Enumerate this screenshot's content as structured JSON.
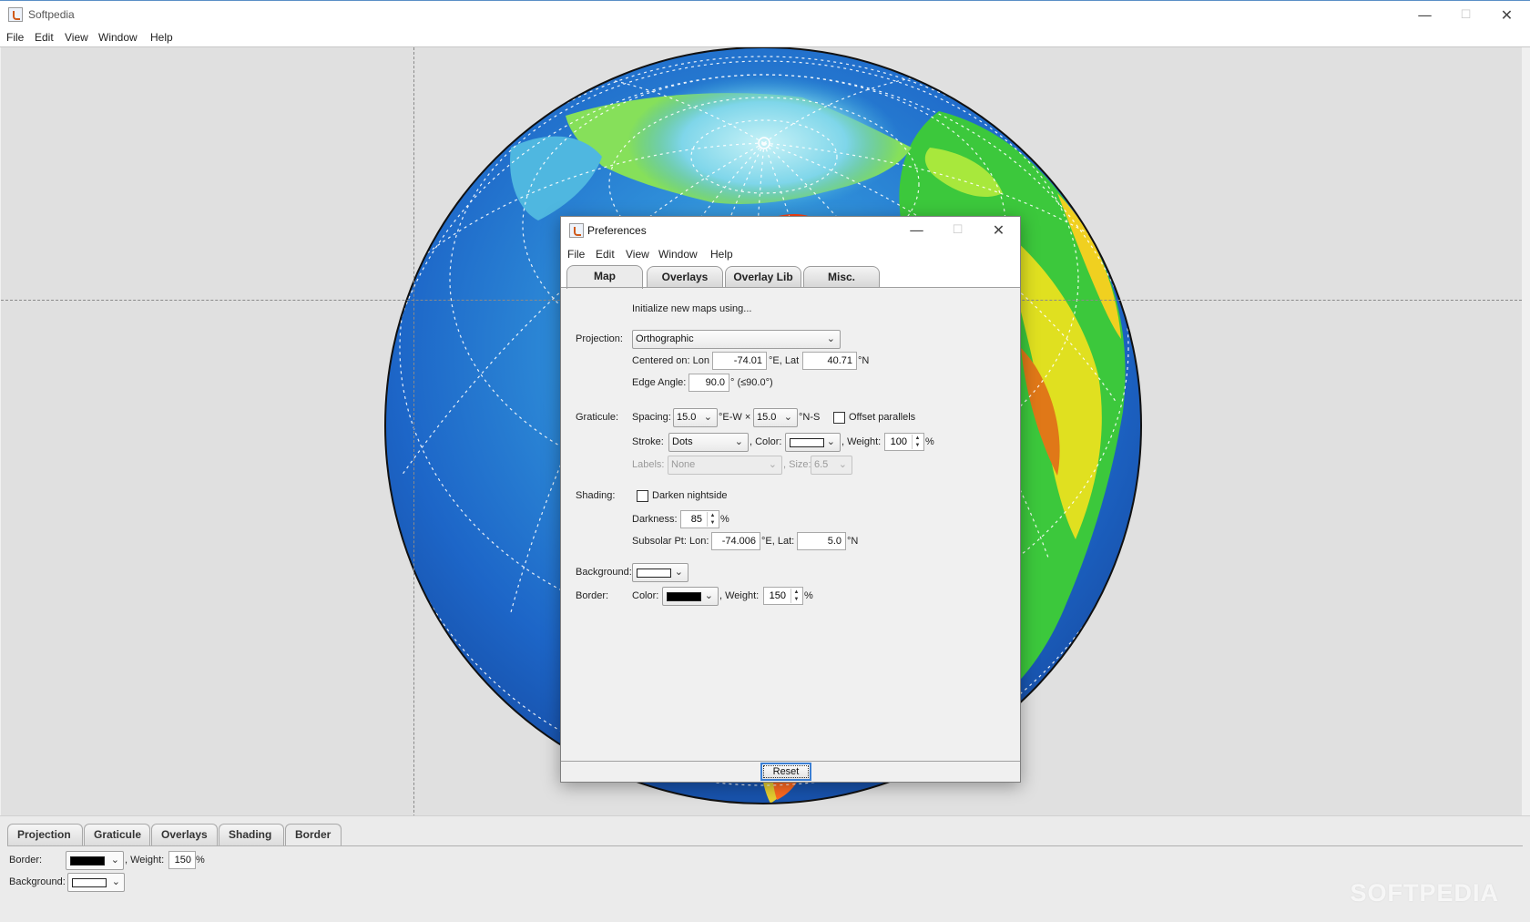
{
  "window": {
    "title": "Softpedia",
    "controls": {
      "minimize": "—",
      "maximize": "☐",
      "close": "✕"
    }
  },
  "menu": [
    "File",
    "Edit",
    "View",
    "Window",
    "Help"
  ],
  "bottom_panel": {
    "tabs": [
      "Projection",
      "Graticule",
      "Overlays",
      "Shading",
      "Border"
    ],
    "active_tab": "Border",
    "border_label": "Border:",
    "weight_label": ", Weight:",
    "weight_value": "150",
    "percent": "%",
    "background_label": "Background:",
    "border_color": "#000000",
    "background_color": "#ffffff"
  },
  "watermark": "SOFTPEDIA",
  "preferences": {
    "title": "Preferences",
    "controls": {
      "minimize": "—",
      "maximize": "☐",
      "close": "✕"
    },
    "menu": [
      "File",
      "Edit",
      "View",
      "Window",
      "Help"
    ],
    "tabs": [
      "Map",
      "Overlays",
      "Overlay Lib",
      "Misc."
    ],
    "active_tab": "Map",
    "intro": "Initialize new maps using...",
    "projection": {
      "label": "Projection:",
      "value": "Orthographic",
      "centered_label": "Centered on: Lon",
      "lon": "-74.01",
      "lon_unit": "°E, Lat",
      "lat": "40.71",
      "lat_unit": "°N",
      "edge_label": "Edge Angle:",
      "edge_value": "90.0",
      "edge_suffix": "° (≤90.0°)"
    },
    "graticule": {
      "label": "Graticule:",
      "spacing_label": "Spacing:",
      "spacing_ew": "15.0",
      "ew_unit": "°E-W ×",
      "spacing_ns": "15.0",
      "ns_unit": "°N-S",
      "offset_label": "Offset parallels",
      "stroke_label": "Stroke:",
      "stroke_value": "Dots",
      "color_label": ", Color:",
      "color": "#ffffff",
      "weight_label": ", Weight:",
      "weight_value": "100",
      "percent": "%",
      "labels_label": "Labels:",
      "labels_value": "None",
      "size_label": ", Size:",
      "size_value": "6.5"
    },
    "shading": {
      "label": "Shading:",
      "darken_label": "Darken nightside",
      "darkness_label": "Darkness:",
      "darkness_value": "85",
      "percent": "%",
      "subsolar_label": "Subsolar Pt: Lon:",
      "lon": "-74.006",
      "lon_unit": "°E, Lat:",
      "lat": "5.0",
      "lat_unit": "°N"
    },
    "background": {
      "label": "Background:",
      "color": "#ffffff"
    },
    "border": {
      "label": "Border:",
      "color_label": "Color:",
      "color": "#000000",
      "weight_label": ", Weight:",
      "weight_value": "150",
      "percent": "%"
    },
    "reset_label": "Reset"
  }
}
